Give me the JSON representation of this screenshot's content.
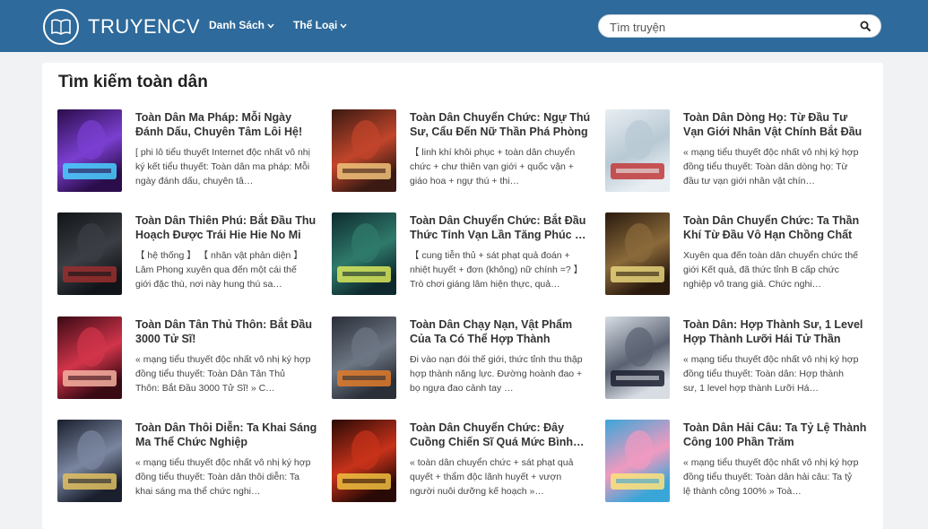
{
  "header": {
    "logo_text": "TRUYENCV",
    "nav": [
      {
        "label": "Danh Sách"
      },
      {
        "label": "Thể Loại"
      }
    ],
    "search_placeholder": "Tìm truyện"
  },
  "section": {
    "title": "Tìm kiếm toàn dân"
  },
  "stories": [
    {
      "title": "Toàn Dân Ma Pháp: Mỗi Ngày Đánh Dấu, Chuyên Tâm Lôi Hệ!",
      "desc": "[ phi lô tiểu thuyết Internet độc nhất vô nhị ký kết tiểu thuyết: Toàn dân ma pháp: Mỗi ngày đánh dấu, chuyên tâ…",
      "cover_colors": [
        "#2a0d4a",
        "#7b3fd1",
        "#4ad0ff"
      ]
    },
    {
      "title": "Toàn Dân Chuyển Chức: Ngự Thú Sư, Cẩu Đến Nữ Thần Phá Phòng",
      "desc": "【 linh khí khôi phục + toàn dân chuyển chức + chư thiên vạn giới + quốc vận + giáo hoa + ngự thú + thi…",
      "cover_colors": [
        "#3a1a12",
        "#c2452b",
        "#f0c27a"
      ]
    },
    {
      "title": "Toàn Dân Dòng Họ: Từ Đầu Tư Vạn Giới Nhân Vật Chính Bắt Đầu",
      "desc": "« mạng tiểu thuyết độc nhất vô nhị ký hợp đồng tiểu thuyết: Toàn dân dòng họ: Từ đầu tư vạn giới nhân vật chín…",
      "cover_colors": [
        "#e8eef2",
        "#b8c9d4",
        "#c23a3a"
      ]
    },
    {
      "title": "Toàn Dân Thiên Phú: Bắt Đầu Thu Hoạch Được Trái Hie Hie No Mi",
      "desc": "【 hệ thống 】 【 nhân vật phản diện 】 Lâm Phong xuyên qua đến một cái thế giới đặc thù, nơi này hung thú sa…",
      "cover_colors": [
        "#111418",
        "#3b3f45",
        "#9a2e2e"
      ]
    },
    {
      "title": "Toàn Dân Chuyển Chức: Bắt Đầu Thức Tỉnh Vạn Lần Tăng Phúc …",
      "desc": "【 cung tiễn thủ + sát phạt quả đoán + nhiệt huyết + đơn (không) nữ chính =? 】 Trò chơi giáng lâm hiện thực, quả…",
      "cover_colors": [
        "#0e2a2e",
        "#2f7a6b",
        "#d9e85a"
      ]
    },
    {
      "title": "Toàn Dân Chuyển Chức: Ta Thần Khí Từ Đầu Vô Hạn Chồng Chất",
      "desc": "Xuyên qua đến toàn dân chuyển chức thế giới Kết quả, đã thức tỉnh B cấp chức nghiệp vô trang giả. Chức nghi…",
      "cover_colors": [
        "#2a1a0e",
        "#8a6a3a",
        "#e6d37a"
      ]
    },
    {
      "title": "Toàn Dân Tân Thủ Thôn: Bắt Đầu 3000 Tử Sĩ!",
      "desc": "« mạng tiểu thuyết độc nhất vô nhị ký hợp đồng tiểu thuyết: Toàn Dân Tân Thủ Thôn: Bắt Đầu 3000 Tử Sĩ! » C…",
      "cover_colors": [
        "#3a0a14",
        "#d2344a",
        "#f5b0a0"
      ]
    },
    {
      "title": "Toàn Dân Chạy Nạn, Vật Phẩm Của Ta Có Thể Hợp Thành",
      "desc": "Đi vào nạn đói thế giới, thức tỉnh thu thập hợp thành năng lực. Đường hoành đao + bọ ngựa đao cảnh tay …",
      "cover_colors": [
        "#2a2f38",
        "#6d7684",
        "#e07a2a"
      ]
    },
    {
      "title": "Toàn Dân: Hợp Thành Sư, 1 Level Hợp Thành Lưỡi Hái Tử Thần",
      "desc": "« mạng tiểu thuyết độc nhất vô nhị ký hợp đồng tiểu thuyết: Toàn dân: Hợp thành sư, 1 level hợp thành Lưỡi Há…",
      "cover_colors": [
        "#d8dde4",
        "#5a6272",
        "#1c2030"
      ]
    },
    {
      "title": "Toàn Dân Thôi Diễn: Ta Khai Sáng Ma Thể Chức Nghiệp",
      "desc": "« mạng tiểu thuyết độc nhất vô nhị ký hợp đồng tiểu thuyết: Toàn dân thôi diễn: Ta khai sáng ma thể chức nghi…",
      "cover_colors": [
        "#1a1f2e",
        "#7a86a0",
        "#e2c060"
      ]
    },
    {
      "title": "Toàn Dân Chuyển Chức: Đây Cuồng Chiến Sĩ Quá Mức Bình…",
      "desc": "« toàn dân chuyển chức + sát phạt quả quyết + thẩm độc lãnh huyết + vượn người nuôi dưỡng kế hoạch »…",
      "cover_colors": [
        "#2a0a06",
        "#c8321a",
        "#f0c040"
      ]
    },
    {
      "title": "Toàn Dân Hải Câu: Ta Tỷ Lệ Thành Công 100 Phần Trăm",
      "desc": "« mạng tiểu thuyết độc nhất vô nhị ký hợp đồng tiểu thuyết: Toàn dân hải câu: Ta tỷ lệ thành công 100% » Toà…",
      "cover_colors": [
        "#3aa6d8",
        "#f09ac0",
        "#ffe27a"
      ]
    }
  ]
}
